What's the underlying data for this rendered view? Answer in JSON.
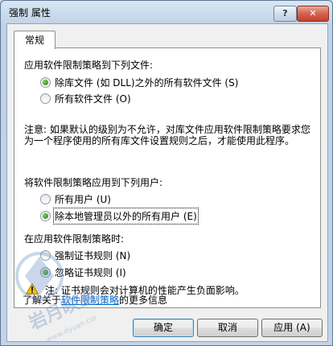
{
  "window": {
    "title": "强制 属性",
    "help_glyph": "?",
    "close_glyph": "✕"
  },
  "tabs": [
    {
      "label": "常规",
      "selected": true
    }
  ],
  "apply_files": {
    "heading": "应用软件限制策略到下列文件:",
    "options": [
      {
        "label": "除库文件 (如 DLL)之外的所有软件文件 (S)",
        "selected": true
      },
      {
        "label": "所有软件文件 (O)",
        "selected": false
      }
    ]
  },
  "note": "注意: 如果默认的级别为不允许，对库文件应用软件限制策略要求您为一个程序使用的所有库文件设置规则之后，才能使用此程序。",
  "apply_users": {
    "heading": "将软件限制策略应用到下列用户:",
    "options": [
      {
        "label": "所有用户 (U)",
        "selected": false
      },
      {
        "label": "除本地管理员以外的所有用户 (E)",
        "selected": true
      }
    ]
  },
  "cert_rules": {
    "heading": "在应用软件限制策略时:",
    "options": [
      {
        "label": "强制证书规则 (N)",
        "selected": false
      },
      {
        "label": "忽略证书规则 (I)",
        "selected": true
      }
    ],
    "warning": "注: 证书规则会对计算机的性能产生负面影响。"
  },
  "learn_more": {
    "prefix": "了解关于",
    "link": "软件限制策略",
    "suffix": "的更多信息"
  },
  "buttons": {
    "ok": "确定",
    "cancel": "取消",
    "apply": "应用 (A)"
  },
  "watermark": {
    "text": "岩月映画",
    "url": "www.dyuan.com"
  }
}
